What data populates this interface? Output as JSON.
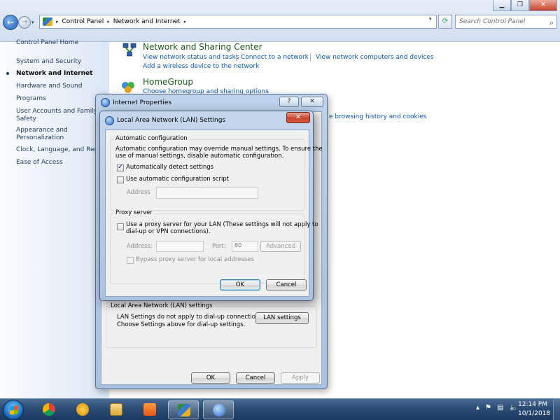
{
  "explorer": {
    "breadcrumb": [
      "Control Panel",
      "Network and Internet"
    ],
    "search_placeholder": "Search Control Panel"
  },
  "left_pane": {
    "items": [
      "Control Panel Home",
      "System and Security",
      "Network and Internet",
      "Hardware and Sound",
      "Programs",
      "User Accounts and Family",
      "Safety",
      "Appearance and",
      "Personalization",
      "Clock, Language, and Regio",
      "Ease of Access"
    ],
    "active_item": "Network and Internet"
  },
  "main": {
    "network_title": "Network and Sharing Center",
    "network_links": [
      "View network status and tasks",
      "Connect to a network",
      "View network computers and devices",
      "Add a wireless device to the network"
    ],
    "homegroup_title": "HomeGroup",
    "homegroup_link": "Choose homegroup and sharing options",
    "internet_link_fragment": "e browsing history and cookies"
  },
  "internet_properties": {
    "title": "Internet Properties",
    "help_glyph": "?",
    "close_glyph": "✕",
    "lan_group_label": "Local Area Network (LAN) settings",
    "lan_text_1": "LAN Settings do not apply to dial-up connections.",
    "lan_text_2": "Choose Settings above for dial-up settings.",
    "lan_button": "LAN settings",
    "ok": "OK",
    "cancel": "Cancel",
    "apply": "Apply"
  },
  "lan_dialog": {
    "title": "Local Area Network (LAN) Settings",
    "close_glyph": "✕",
    "auto_group": "Automatic configuration",
    "auto_desc_1": "Automatic configuration may override manual settings.  To ensure the",
    "auto_desc_2": "use of manual settings, disable automatic configuration.",
    "auto_detect": "Automatically detect settings",
    "auto_detect_checked": true,
    "use_script": "Use automatic configuration script",
    "use_script_checked": false,
    "address_label": "Address",
    "proxy_group": "Proxy server",
    "proxy_text_1": "Use a proxy server for your LAN (These settings will not apply to",
    "proxy_text_2": "dial-up or VPN connections).",
    "proxy_checked": false,
    "proxy_address_label": "Address:",
    "port_label": "Port:",
    "port_value": "80",
    "advanced": "Advanced",
    "bypass": "Bypass proxy server for local addresses",
    "ok": "OK",
    "cancel": "Cancel"
  },
  "taskbar": {
    "time": "12:14 PM",
    "date": "10/1/2018"
  },
  "colors": {
    "link": "#0a58b0",
    "category_title": "#1e5a1e",
    "taskbar": "#2a4b73"
  }
}
